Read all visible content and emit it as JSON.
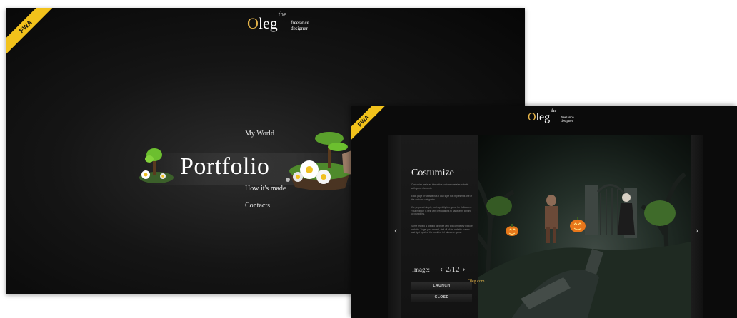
{
  "home": {
    "badge": "FWA",
    "logo": {
      "first": "O",
      "rest": "leg",
      "sup": "the",
      "tagline_1": "freelance",
      "tagline_2": "designer"
    },
    "menu": {
      "my_world": "My World",
      "portfolio": "Portfolio",
      "how_made": "How it's made",
      "contacts": "Contacts"
    }
  },
  "project": {
    "badge": "FWA",
    "logo": {
      "first": "O",
      "rest": "leg",
      "sup": "the",
      "tagline_1": "freelance",
      "tagline_2": "designer"
    },
    "title": "Costumize",
    "paragraphs": [
      "Costumize.me is an interactive costumes retailer website with game elements.",
      "Each page of website has it own style that represents one of the costume categories.",
      "We prepared simple, but hopefully fun, game for Halloween. Your mission is help with preparations to halloween, lighting up pumpkins.",
      "Some reward is waiting for those who will completely explore website. To get your reward, visit all of the website scenes and light up all of the pumkins in Halloween game."
    ],
    "image_label": "Image:",
    "image_counter": "2/12",
    "launch_label": "LAUNCH",
    "close_label": "CLOSE",
    "url_label": "Oleg.com",
    "nav_prev": "‹",
    "nav_next": "›"
  },
  "colors": {
    "accent": "#e6b54a",
    "badge": "#f2c21b",
    "background": "#0b0b0b"
  }
}
